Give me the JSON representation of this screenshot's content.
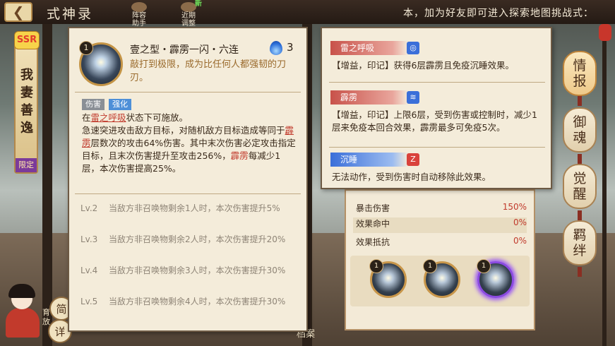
{
  "window": {
    "title": "式神录"
  },
  "topbar": {
    "back_icon": "arrow-left-icon",
    "buttons": [
      {
        "label": "阵容助手"
      },
      {
        "label": "近期调整",
        "badge": "新"
      }
    ],
    "marquee": "本，加为好友即可进入探索地图挑战式："
  },
  "character": {
    "rarity": "SSR",
    "name": "我妻善逸",
    "limited_label": "限定"
  },
  "left_buttons": {
    "simple_label": "简",
    "detail_label": "详",
    "partial_label": "育\n放"
  },
  "side_tabs": [
    "情报",
    "御魂",
    "觉醒",
    "羁绊"
  ],
  "skill": {
    "level": "1",
    "name": "壹之型・霹雳一闪・六连",
    "cost": "3",
    "quote": "敲打到极限，成为比任何人都强韧的刀刃。",
    "tags": [
      "伤害",
      "强化"
    ],
    "condition_pre": "在",
    "condition_kw": "雷之呼吸",
    "condition_post": "状态下可施放。",
    "desc_1": "急速突进攻击敌方目标，对随机敌方目标造成等同于",
    "desc_kw1": "霹雳",
    "desc_2": "层数次的攻击64%伤害。其中末次伤害必定攻击指定目标，且末次伤害提升至攻击256%，",
    "desc_kw2": "霹雳",
    "desc_3": "每减少1层，本次伤害提高25%。",
    "levels": [
      {
        "lv": "Lv.2",
        "text": "当敌方非召唤物剩余1人时，本次伤害提升5%"
      },
      {
        "lv": "Lv.3",
        "text": "当敌方非召唤物剩余2人时，本次伤害提升20%"
      },
      {
        "lv": "Lv.4",
        "text": "当敌方非召唤物剩余3人时，本次伤害提升30%"
      },
      {
        "lv": "Lv.5",
        "text": "当敌方非召唤物剩余4人时，本次伤害提升30%"
      }
    ]
  },
  "keywords": [
    {
      "name": "雷之呼吸",
      "color": "#c8524a",
      "icon_name": "thunder-breath-icon",
      "icon_color": "#3b6fd9",
      "text": "【增益，印记】获得6层霹雳且免疫沉睡效果。"
    },
    {
      "name": "霹雳",
      "color": "#c8524a",
      "icon_name": "thunder-strike-icon",
      "icon_color": "#3b6fd9",
      "text": "【增益，印记】上限6层，受到伤害或控制时，减少1层来免疫本回合效果，霹雳最多可免疫5次。"
    },
    {
      "name": "沉睡",
      "color": "#3b6fd9",
      "icon_name": "sleep-icon",
      "icon_color": "#d9423b",
      "icon_glyph": "Z",
      "text": "无法动作，受到伤害时自动移除此效果。"
    }
  ],
  "stats": [
    {
      "label": "暴击伤害",
      "value": "150%"
    },
    {
      "label": "效果命中",
      "value": "0%"
    },
    {
      "label": "效果抵抗",
      "value": "0%"
    }
  ],
  "skill_strip": [
    {
      "level": "1",
      "selected": false
    },
    {
      "level": "1",
      "selected": false
    },
    {
      "level": "1",
      "selected": true
    }
  ],
  "bottom_partial": "档案"
}
